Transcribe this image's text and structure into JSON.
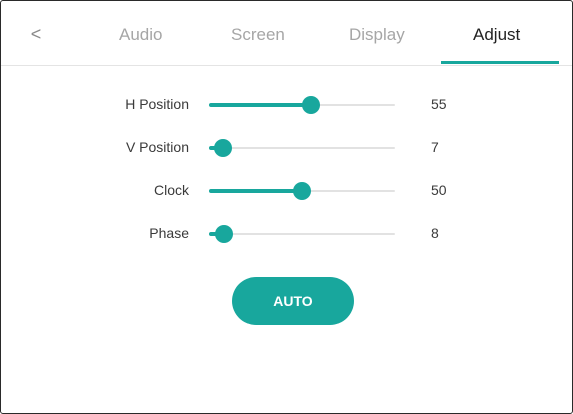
{
  "nav": {
    "back_symbol": "<",
    "tabs": [
      {
        "label": "Audio",
        "active": false
      },
      {
        "label": "Screen",
        "active": false
      },
      {
        "label": "Display",
        "active": false
      },
      {
        "label": "Adjust",
        "active": true
      }
    ]
  },
  "sliders": [
    {
      "label": "H Position",
      "value": "55",
      "level": 0.55
    },
    {
      "label": "V Position",
      "value": "7",
      "level": 0.07
    },
    {
      "label": "Clock",
      "value": "50",
      "level": 0.5
    },
    {
      "label": "Phase",
      "value": "8",
      "level": 0.08
    }
  ],
  "auto_button": {
    "label": "AUTO"
  },
  "colors": {
    "accent": "#18a79d",
    "track": "#e2e2e2",
    "inactive_tab": "#a6a6a6",
    "active_tab": "#222222",
    "text": "#3a3a3a"
  },
  "icons": {
    "back": "chevron-left-icon"
  }
}
